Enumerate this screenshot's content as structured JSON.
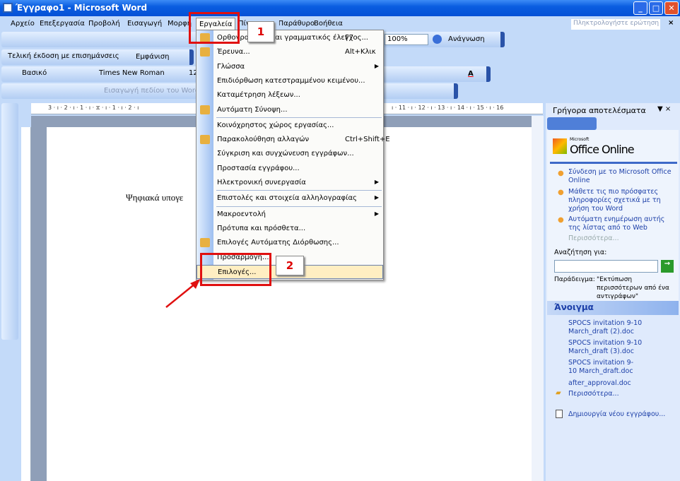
{
  "window": {
    "title": "Έγγραφο1 - Microsoft Word",
    "minimize": "_",
    "maximize": "□",
    "close": "✕"
  },
  "menubar": {
    "items": [
      "Αρχείο",
      "Επεξεργασία",
      "Προβολή",
      "Εισαγωγή",
      "Μορφή",
      "Εργαλεία",
      "Πίνακας",
      "Παράθυρο",
      "Βοήθεια"
    ],
    "ask_placeholder": "Πληκτρολογήστε ερώτηση"
  },
  "toolbars": {
    "zoom": "100%",
    "read": "Ανάγνωση",
    "markup": "Τελική έκδοση με επισημάνσεις",
    "show": "Εμφάνιση",
    "style": "Βασικό",
    "font": "Times New Roman",
    "size": "12",
    "field": "Εισαγωγή πεδίου του Word"
  },
  "ruler": {
    "ticks": "3 · ı · 2 · ı · 1 · ı · ⧖ · ı · 1 · ı · 2 · ı",
    "ticks_right": "ı · 11 · ı · 12 · ı · 13 · ı · 14 · ı · 15 · ı · 16"
  },
  "document": {
    "text": "Ψηφιακά υπογε"
  },
  "tools_menu": {
    "items": [
      {
        "label": "Ορθογραφικός και γραμματικός έλεγχος...",
        "shortcut": "F7",
        "icon": "spelling-icon"
      },
      {
        "label": "Έρευνα...",
        "shortcut": "Alt+Κλικ",
        "icon": "research-icon"
      },
      {
        "label": "Γλώσσα",
        "submenu": true
      },
      {
        "label": "Επιδιόρθωση κατεστραμμένου κειμένου..."
      },
      {
        "label": "Καταμέτρηση λέξεων..."
      },
      {
        "label": "Αυτόματη Σύνοψη...",
        "icon": "autosummary-icon"
      },
      {
        "label": "Κοινόχρηστος χώρος εργασίας...",
        "sep": true
      },
      {
        "label": "Παρακολούθηση αλλαγών",
        "shortcut": "Ctrl+Shift+E",
        "icon": "track-changes-icon"
      },
      {
        "label": "Σύγκριση και συγχώνευση εγγράφων..."
      },
      {
        "label": "Προστασία εγγράφου..."
      },
      {
        "label": "Ηλεκτρονική συνεργασία",
        "submenu": true
      },
      {
        "label": "Επιστολές και στοιχεία αλληλογραφίας",
        "submenu": true,
        "sep": true
      },
      {
        "label": "Μακροεντολή",
        "submenu": true,
        "sep": true
      },
      {
        "label": "Πρότυπα και πρόσθετα..."
      },
      {
        "label": "Επιλογές Αυτόματης Διόρθωσης...",
        "icon": "autocorrect-icon"
      },
      {
        "label": "Προσαρμογή..."
      },
      {
        "label": "Επιλογές...",
        "highlighted": true
      }
    ]
  },
  "annotations": {
    "step1": "1",
    "step2": "2",
    "color": "#e01010"
  },
  "task_pane": {
    "title": "Γρήγορα αποτελέσματα",
    "brand": "Office Online",
    "brand_small": "Microsoft",
    "links": [
      "Σύνδεση με το Microsoft Office Online",
      "Μάθετε τις πιο πρόσφατες πληροφορίες σχετικά με τη χρήση του Word",
      "Αυτόματη ενημέρωση αυτής της λίστας από το Web"
    ],
    "more": "Περισσότερα...",
    "search_label": "Αναζήτηση για:",
    "search_value": "",
    "example_label": "Παράδειγμα:",
    "example_text": "\"Εκτύπωση περισσότερων από ένα αντιγράφων\"",
    "open_title": "Άνοιγμα",
    "files": [
      "SPOCS invitation 9-10 March_draft (2).doc",
      "SPOCS invitation 9-10 March_draft (3).doc",
      "SPOCS invitation 9-10 March_draft.doc",
      "after_approval.doc"
    ],
    "more_files": "Περισσότερα...",
    "new_doc": "Δημιουργία νέου εγγράφου..."
  }
}
